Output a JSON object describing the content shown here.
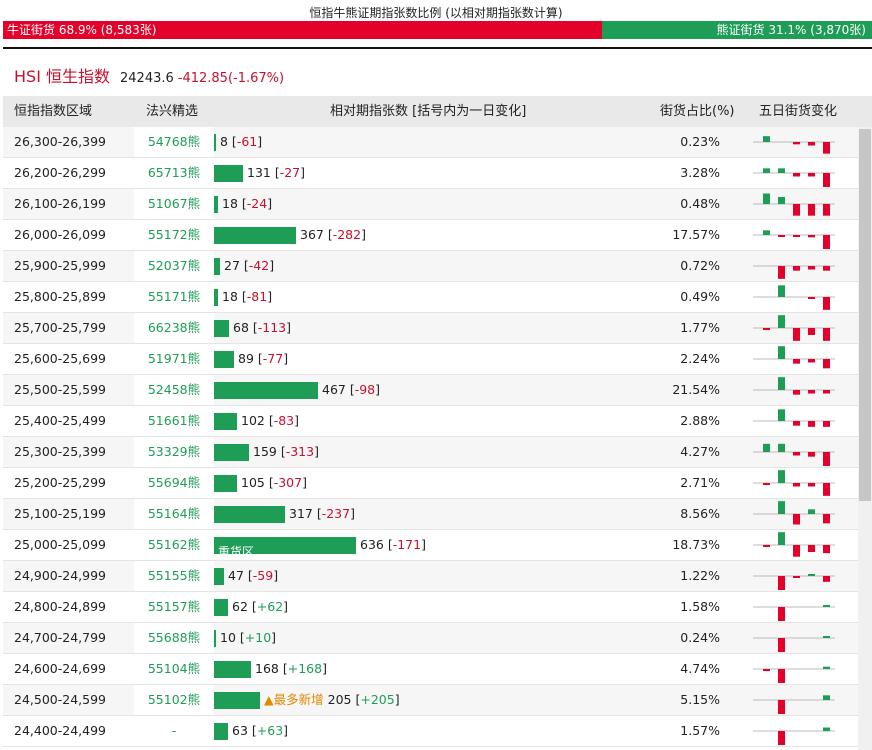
{
  "ratio": {
    "title": "恒指牛熊证期指张数比例 (以相对期指张数计算)",
    "bull_label": "牛证街货 68.9% (8,583张)",
    "bear_label": "熊证街货 31.1% (3,870张)",
    "bull_fraction": 0.689,
    "bull_color": "#e3002b",
    "bear_color": "#1e9d56"
  },
  "index": {
    "name": "HSI 恒生指数",
    "price": "24243.6",
    "change": "-412.85(-1.67%)"
  },
  "headers": {
    "range": "恒指指数区域",
    "pick": "法兴精选",
    "contracts": "相对期指张数 [括号内为一日变化]",
    "share": "街货占比(%)",
    "five_day": "五日街货变化"
  },
  "rows": [
    {
      "range": "26,300-26,399",
      "code": "54768熊",
      "count": 8,
      "change": "-61",
      "pct": "0.23%",
      "tag": "",
      "spark": [
        0.25,
        0,
        -0.1,
        -0.15,
        -0.5
      ]
    },
    {
      "range": "26,200-26,299",
      "code": "65713熊",
      "count": 131,
      "change": "-27",
      "pct": "3.28%",
      "tag": "",
      "spark": [
        0.2,
        0.2,
        -0.15,
        -0.15,
        -0.6
      ]
    },
    {
      "range": "26,100-26,199",
      "code": "51067熊",
      "count": 18,
      "change": "-24",
      "pct": "0.48%",
      "tag": "",
      "spark": [
        0.45,
        0.3,
        -0.5,
        -0.5,
        -0.5
      ]
    },
    {
      "range": "26,000-26,099",
      "code": "55172熊",
      "count": 367,
      "change": "-282",
      "pct": "17.57%",
      "tag": "",
      "spark": [
        0.2,
        -0.05,
        -0.05,
        -0.1,
        -0.6
      ]
    },
    {
      "range": "25,900-25,999",
      "code": "52037熊",
      "count": 27,
      "change": "-42",
      "pct": "0.72%",
      "tag": "",
      "spark": [
        0,
        -0.55,
        -0.2,
        -0.15,
        -0.2
      ]
    },
    {
      "range": "25,800-25,899",
      "code": "55171熊",
      "count": 18,
      "change": "-81",
      "pct": "0.49%",
      "tag": "",
      "spark": [
        0,
        0.5,
        0,
        -0.05,
        -0.55
      ]
    },
    {
      "range": "25,700-25,799",
      "code": "66238熊",
      "count": 68,
      "change": "-113",
      "pct": "1.77%",
      "tag": "",
      "spark": [
        -0.05,
        0.55,
        -0.55,
        -0.3,
        -0.55
      ]
    },
    {
      "range": "25,600-25,699",
      "code": "51971熊",
      "count": 89,
      "change": "-77",
      "pct": "2.24%",
      "tag": "",
      "spark": [
        0,
        0.55,
        -0.2,
        -0.15,
        -0.4
      ]
    },
    {
      "range": "25,500-25,599",
      "code": "52458熊",
      "count": 467,
      "change": "-98",
      "pct": "21.54%",
      "tag": "",
      "spark": [
        0,
        0.55,
        -0.2,
        -0.15,
        -0.15
      ]
    },
    {
      "range": "25,400-25,499",
      "code": "51661熊",
      "count": 102,
      "change": "-83",
      "pct": "2.88%",
      "tag": "",
      "spark": [
        0,
        0.5,
        -0.2,
        -0.25,
        -0.25
      ]
    },
    {
      "range": "25,300-25,399",
      "code": "53329熊",
      "count": 159,
      "change": "-313",
      "pct": "4.27%",
      "tag": "",
      "spark": [
        0.35,
        0.35,
        -0.15,
        -0.2,
        -0.6
      ]
    },
    {
      "range": "25,200-25,299",
      "code": "55694熊",
      "count": 105,
      "change": "-307",
      "pct": "2.71%",
      "tag": "",
      "spark": [
        -0.05,
        0.55,
        -0.15,
        -0.15,
        -0.55
      ]
    },
    {
      "range": "25,100-25,199",
      "code": "55164熊",
      "count": 317,
      "change": "-237",
      "pct": "8.56%",
      "tag": "",
      "spark": [
        0,
        0.55,
        -0.45,
        0.2,
        -0.4
      ]
    },
    {
      "range": "25,000-25,099",
      "code": "55162熊",
      "count": 636,
      "change": "-171",
      "pct": "18.73%",
      "tag": "",
      "inner": "重货区",
      "spark": [
        -0.05,
        0.55,
        -0.5,
        -0.3,
        -0.35
      ]
    },
    {
      "range": "24,900-24,999",
      "code": "55155熊",
      "count": 47,
      "change": "-59",
      "pct": "1.22%",
      "tag": "",
      "spark": [
        0,
        -0.6,
        -0.05,
        0.05,
        -0.25
      ]
    },
    {
      "range": "24,800-24,899",
      "code": "55157熊",
      "count": 62,
      "change": "+62",
      "pct": "1.58%",
      "tag": "",
      "spark": [
        0,
        -0.6,
        0,
        0,
        0.05
      ]
    },
    {
      "range": "24,700-24,799",
      "code": "55688熊",
      "count": 10,
      "change": "+10",
      "pct": "0.24%",
      "tag": "",
      "spark": [
        0,
        -0.6,
        0,
        0,
        0.05
      ]
    },
    {
      "range": "24,600-24,699",
      "code": "55104熊",
      "count": 168,
      "change": "+168",
      "pct": "4.74%",
      "tag": "",
      "spark": [
        -0.05,
        -0.6,
        0,
        0,
        0.1
      ]
    },
    {
      "range": "24,500-24,599",
      "code": "55102熊",
      "count": 205,
      "change": "+205",
      "pct": "5.15%",
      "tag": "▲最多新增",
      "spark": [
        0,
        -0.6,
        0,
        0,
        0.2
      ]
    },
    {
      "range": "24,400-24,499",
      "code": "-",
      "count": 63,
      "change": "+63",
      "pct": "1.57%",
      "tag": "",
      "spark": [
        0,
        -0.6,
        0,
        0,
        0.15
      ]
    }
  ],
  "colors": {
    "up": "#1e9d56",
    "down": "#e3002b",
    "accent": "#c8102e"
  }
}
